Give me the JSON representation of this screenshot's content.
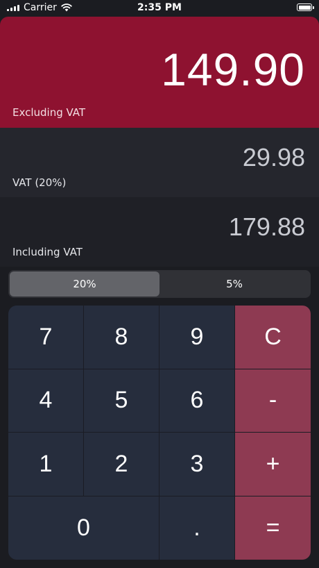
{
  "status_bar": {
    "carrier": "Carrier",
    "time": "2:35 PM"
  },
  "excluding": {
    "value": "149.90",
    "label": "Excluding VAT"
  },
  "vat": {
    "value": "29.98",
    "label": "VAT (20%)"
  },
  "including": {
    "value": "179.88",
    "label": "Including VAT"
  },
  "rate_selector": {
    "options": [
      "20%",
      "5%"
    ],
    "selected": "20%"
  },
  "keypad": {
    "keys": [
      "7",
      "8",
      "9",
      "C",
      "4",
      "5",
      "6",
      "-",
      "1",
      "2",
      "3",
      "+",
      "0",
      ".",
      "="
    ]
  },
  "colors": {
    "accent_red": "#8e1230",
    "operator_key": "#8e3a52",
    "digit_key": "#262d3d",
    "background": "#1b1c21"
  }
}
